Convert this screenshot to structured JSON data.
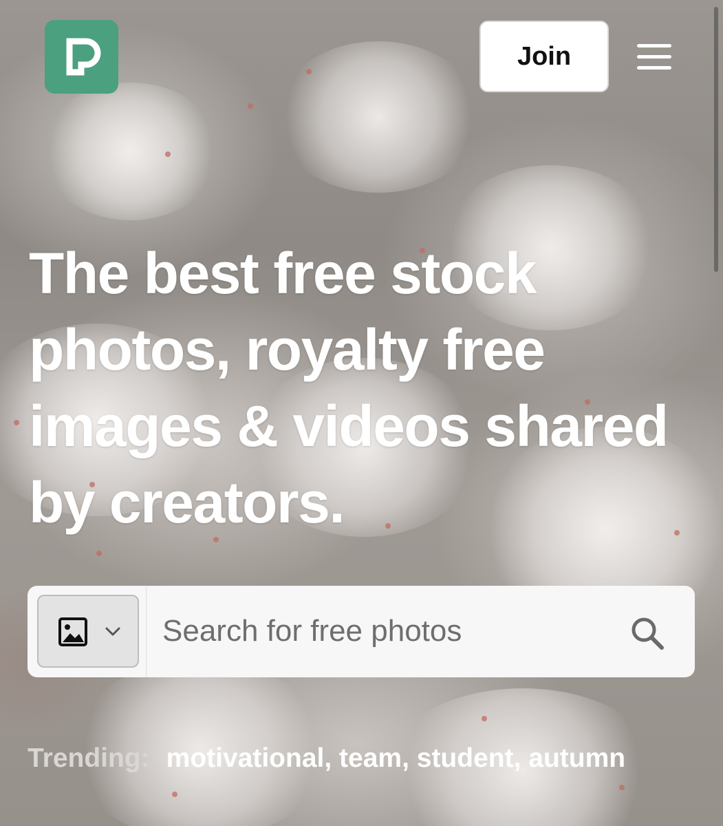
{
  "header": {
    "logo_icon": "pexels-logo-icon",
    "logo_color": "#4aa07f",
    "join_label": "Join",
    "menu_icon": "hamburger-menu-icon"
  },
  "hero": {
    "headline": "The best free stock photos, royalty free images & videos shared by creators."
  },
  "search": {
    "type_icon": "image-icon",
    "dropdown_icon": "chevron-down-icon",
    "placeholder": "Search for free photos",
    "submit_icon": "search-icon"
  },
  "trending": {
    "label": "Trending:",
    "items": [
      "motivational",
      "team",
      "student",
      "autumn"
    ]
  }
}
